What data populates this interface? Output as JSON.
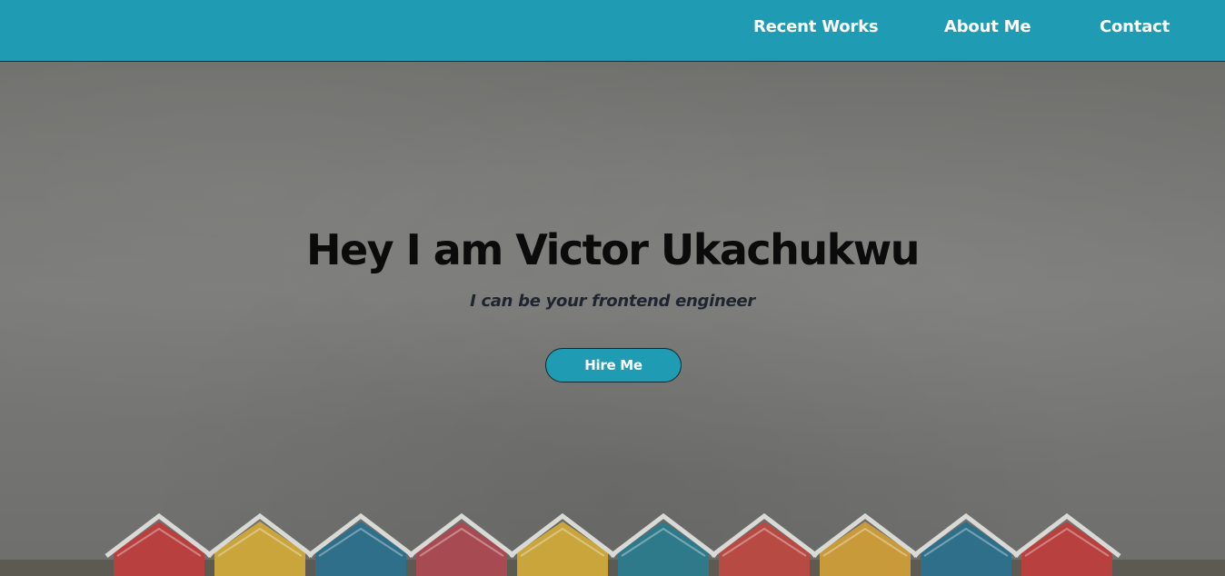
{
  "nav": {
    "links": [
      {
        "label": "Recent Works"
      },
      {
        "label": "About Me"
      },
      {
        "label": "Contact"
      }
    ]
  },
  "hero": {
    "title": "Hey I am Victor Ukachukwu",
    "subtitle": "I can be your frontend engineer",
    "cta_label": "Hire Me"
  },
  "colors": {
    "accent": "#1f9bb3",
    "hero_overlay": "#747472",
    "title_text": "#0b0b0b",
    "subtitle_text": "#1e2430",
    "hut_colors": [
      "#b8403f",
      "#c9a53c",
      "#2f6f8a",
      "#a84a52",
      "#c9a53c",
      "#2f7a8a",
      "#b84a44",
      "#c99a3a",
      "#2f6f8a",
      "#b8403f"
    ]
  }
}
